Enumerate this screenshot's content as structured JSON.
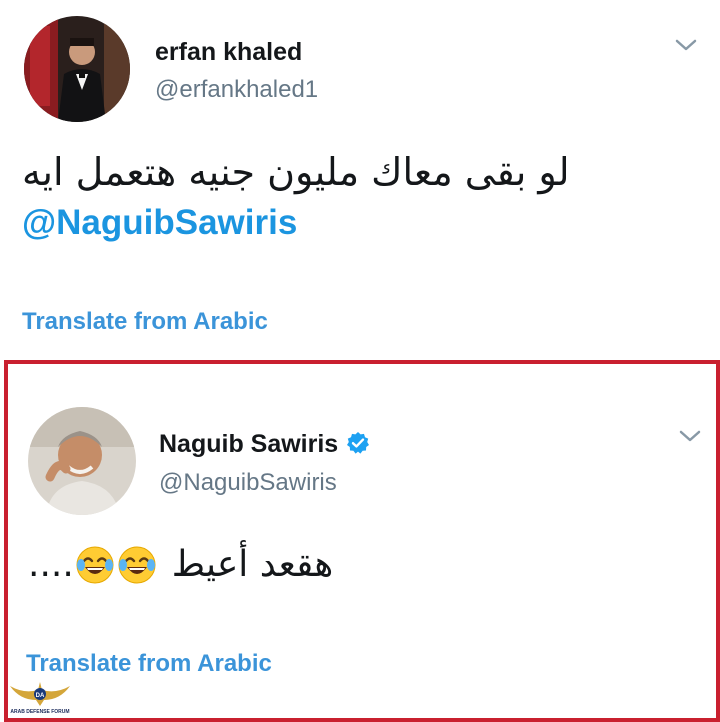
{
  "tweets": [
    {
      "display_name": "erfan khaled",
      "handle": "@erfankhaled1",
      "text": "لو بقى معاك مليون جنيه هتعمل ايه",
      "mention": "@NaguibSawiris",
      "translate_label": "Translate from Arabic",
      "verified": false
    },
    {
      "display_name": "Naguib Sawiris",
      "handle": "@NaguibSawiris",
      "text": "هقعد أعيط",
      "trailing": "....",
      "translate_label": "Translate from Arabic",
      "verified": true,
      "emoji": [
        "face-with-tears-of-joy",
        "face-with-tears-of-joy"
      ]
    }
  ],
  "colors": {
    "link": "#1b95e0",
    "highlight_border": "#c9202f",
    "verified": "#1da1f2"
  },
  "watermark": {
    "text": "ARAB DEFENSE FORUM",
    "logo_text": "DA"
  }
}
